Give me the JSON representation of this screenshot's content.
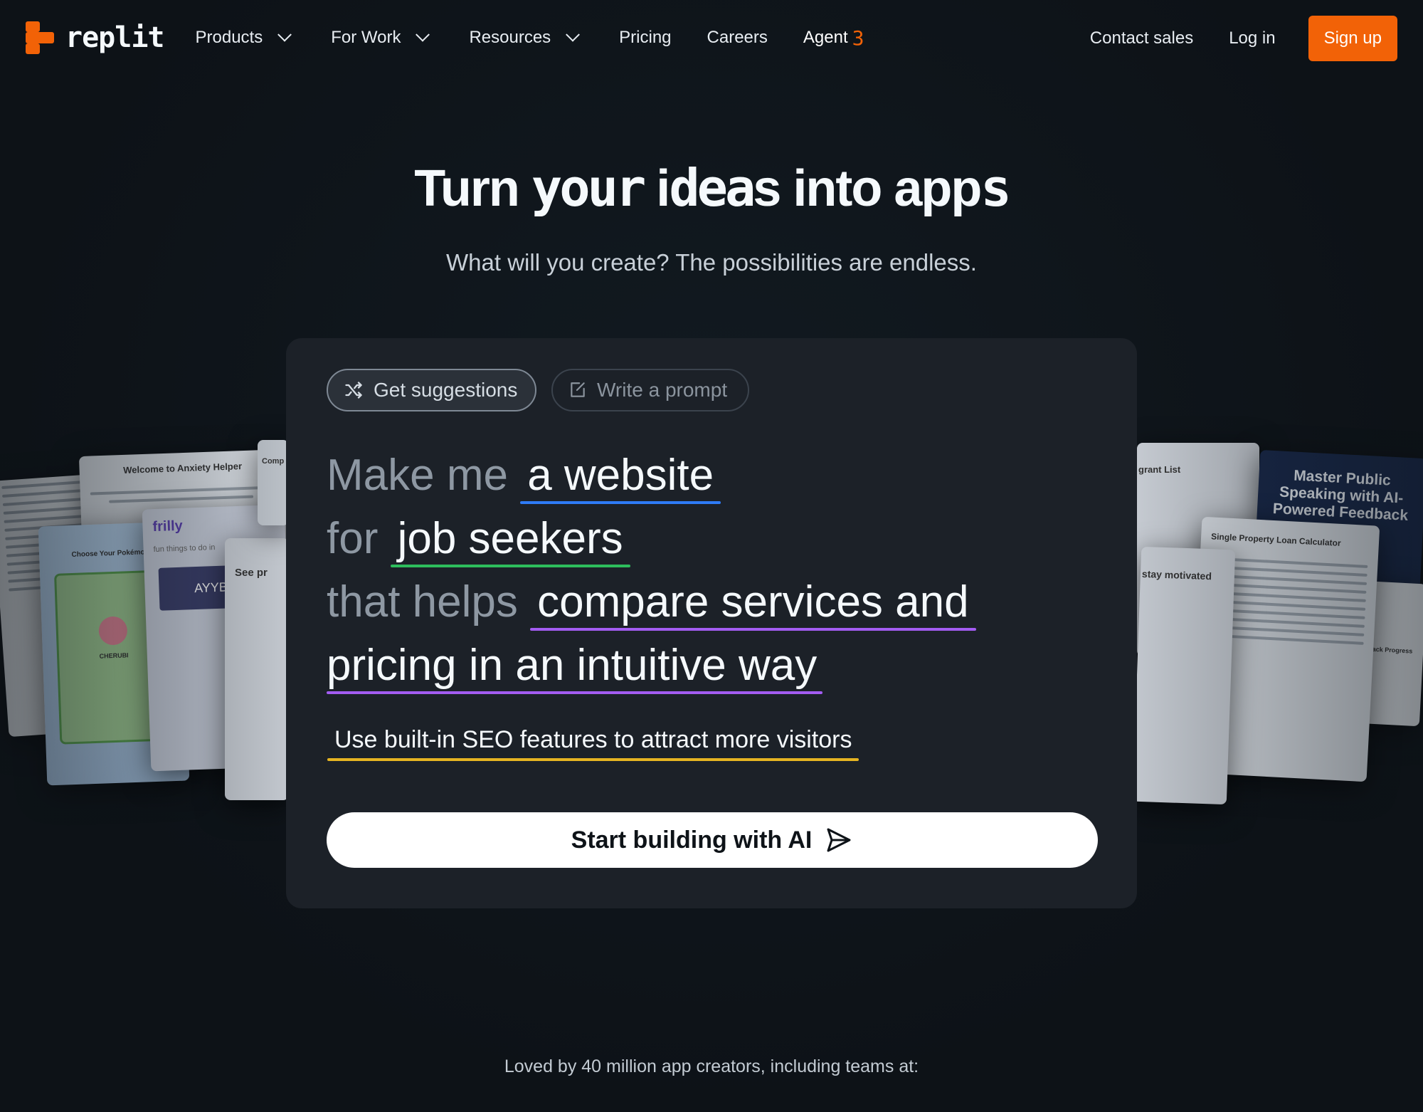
{
  "nav": {
    "logo_text": "replit",
    "items": [
      {
        "label": "Products",
        "has_dropdown": true
      },
      {
        "label": "For Work",
        "has_dropdown": true
      },
      {
        "label": "Resources",
        "has_dropdown": true
      },
      {
        "label": "Pricing",
        "has_dropdown": false
      },
      {
        "label": "Careers",
        "has_dropdown": false
      }
    ],
    "agent_label": "Agent",
    "agent_version": "3",
    "contact_sales": "Contact sales",
    "log_in": "Log in",
    "sign_up": "Sign up"
  },
  "hero": {
    "title_a": "Turn ",
    "title_b": "your",
    "title_c": " i",
    "title_d": "dea",
    "title_e": "s into app",
    "title_f": "s",
    "subtitle": "What will you create? The possibilities are endless."
  },
  "composer": {
    "tab_suggestions": "Get suggestions",
    "tab_prompt": "Write a prompt",
    "prompt": {
      "p1": "Make me",
      "s1": "a website",
      "p2": "for",
      "s2": "job seekers",
      "p3": "that helps",
      "s3": "compare services and",
      "s4": "pricing in an intuitive way"
    },
    "feature": "Use built-in SEO features to attract more visitors",
    "cta": "Start building with AI"
  },
  "showcase": {
    "left_cards": [
      "Welcome to Anxiety Helper",
      "Choose Your Pokémon",
      "CHERUBI",
      "frilly",
      "fun things to do in",
      "AYYBO",
      "See pr",
      "Comp"
    ],
    "right_cards": [
      "grant List",
      "Master Public Speaking with AI-Powered Feedback",
      "Single Property Loan Calculator",
      "stay motivated",
      "Track Progress"
    ]
  },
  "footer": {
    "loved_by": "Loved by 40 million app creators, including teams at:"
  },
  "colors": {
    "background": "#0e1318",
    "panel": "#1c2128",
    "accent": "#f26207",
    "underline_blue": "#2e7bf6",
    "underline_green": "#2dbd5c",
    "underline_purple": "#a35cf2",
    "underline_yellow": "#e6b422"
  }
}
